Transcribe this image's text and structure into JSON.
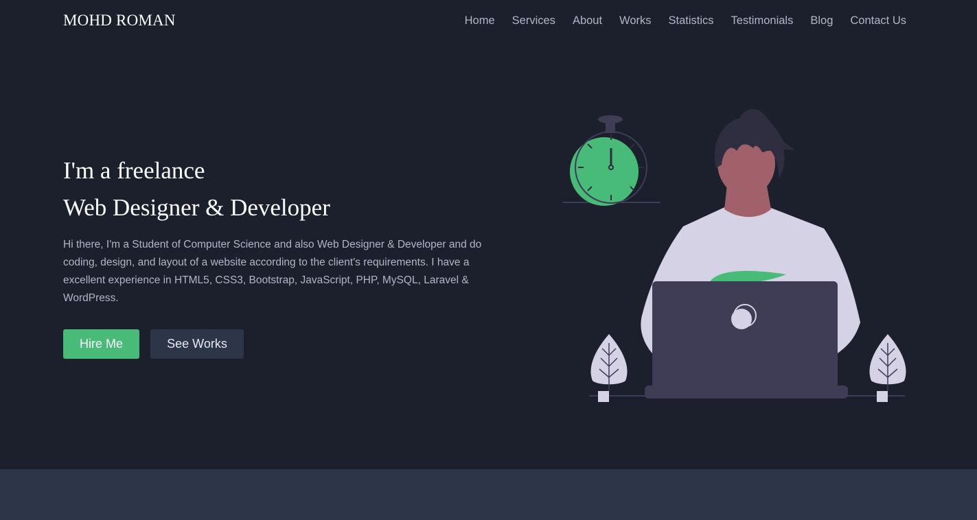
{
  "header": {
    "brand": "MOHD ROMAN",
    "nav": [
      {
        "label": "Home"
      },
      {
        "label": "Services"
      },
      {
        "label": "About"
      },
      {
        "label": "Works"
      },
      {
        "label": "Statistics"
      },
      {
        "label": "Testimonials"
      },
      {
        "label": "Blog"
      },
      {
        "label": "Contact Us"
      }
    ]
  },
  "hero": {
    "line1": "I'm a freelance",
    "line2": "Web Designer & Developer",
    "description": "Hi there, I'm a Student of Computer Science and also Web Designer & Developer and do coding, design, and layout of a website according to the client's requirements. I have a excellent experience in HTML5, CSS3, Bootstrap, JavaScript, PHP, MySQL, Laravel & WordPress.",
    "hire_label": "Hire Me",
    "works_label": "See Works"
  },
  "colors": {
    "background": "#1b202c",
    "accent": "#48bb78",
    "secondary_button": "#2d3548",
    "text_muted": "#aeb6c8"
  }
}
